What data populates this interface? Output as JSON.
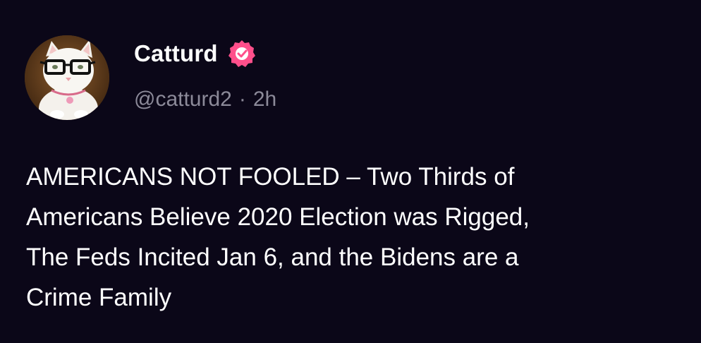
{
  "post": {
    "author": {
      "display_name": "Catturd",
      "handle": "@catturd2",
      "verified_icon": "verified-badge-icon",
      "avatar_icon": "cat-with-glasses-avatar"
    },
    "separator": "·",
    "time_ago": "2h",
    "text": "AMERICANS NOT FOOLED – Two Thirds of\nAmericans Believe 2020 Election was Rigged,\nThe Feds Incited Jan 6, and the Bidens are a\nCrime Family"
  },
  "colors": {
    "background": "#0b0718",
    "text": "#ffffff",
    "muted": "#8c8a99",
    "verified": "#ff4f8b"
  }
}
